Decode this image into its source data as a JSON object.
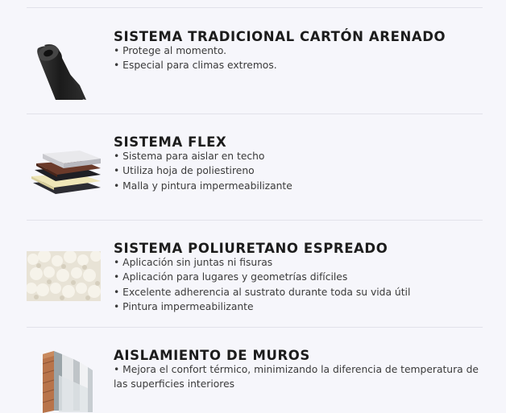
{
  "sections": [
    {
      "title": "SISTEMA TRADICIONAL CARTÓN ARENADO",
      "image": "roll-of-sanded-roofing-felt-icon",
      "bullets": [
        "Protege al momento.",
        "Especial para climas extremos."
      ]
    },
    {
      "title": "SISTEMA FLEX",
      "image": "layered-roofing-sheets-icon",
      "bullets": [
        "Sistema para aislar en techo",
        "Utiliza hoja de poliestireno",
        "Malla y pintura impermeabilizante"
      ]
    },
    {
      "title": "SISTEMA POLIURETANO ESPREADO",
      "image": "sprayed-polyurethane-foam-icon",
      "bullets": [
        "Aplicación sin juntas ni fisuras",
        "Aplicación para lugares y geometrías difíciles",
        "Excelente adherencia al sustrato durante toda su vida útil",
        "Pintura impermeabilizante"
      ]
    },
    {
      "title": "AISLAMIENTO DE MUROS",
      "image": "insulated-wall-layers-icon",
      "bullets": [
        "Mejora el confort térmico, minimizando la diferencia de temperatura de las superficies interiores"
      ]
    }
  ]
}
